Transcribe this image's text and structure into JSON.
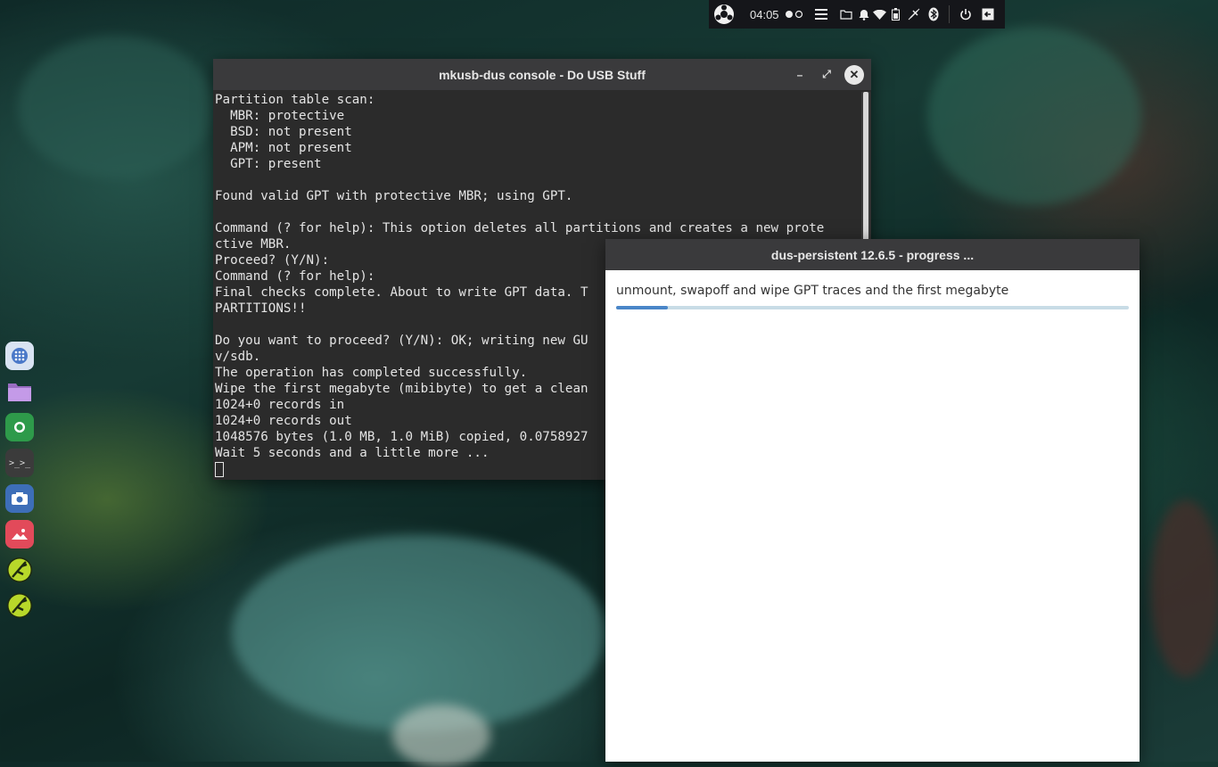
{
  "top_panel": {
    "logo_icon": "ubuntu-budgie-logo-icon",
    "clock": "04:05",
    "icons": [
      "workspace-dots-icon",
      "menu-icon",
      "folder-icon",
      "bell-icon",
      "wifi-icon",
      "battery-icon",
      "network-off-icon",
      "bluetooth-icon",
      "power-icon",
      "logout-icon"
    ]
  },
  "dock": {
    "items": [
      {
        "name": "app-grid-icon",
        "color": "#c8d6ea"
      },
      {
        "name": "files-icon",
        "color": "#b58ad8"
      },
      {
        "name": "chrome-icon",
        "color": "#2e9a4a"
      },
      {
        "name": "terminal-icon",
        "color": "#3b3b3b"
      },
      {
        "name": "screenshot-icon",
        "color": "#3d6eb8"
      },
      {
        "name": "image-viewer-icon",
        "color": "#e24a5a"
      },
      {
        "name": "mkusb-icon",
        "color": "#b8d82a"
      },
      {
        "name": "mkusb-icon-2",
        "color": "#b8d82a"
      }
    ]
  },
  "console": {
    "title": "mkusb-dus console - Do USB Stuff",
    "minimize": "–",
    "maximize": "⤢",
    "close": "✕",
    "lines": [
      "Partition table scan:",
      "  MBR: protective",
      "  BSD: not present",
      "  APM: not present",
      "  GPT: present",
      "",
      "Found valid GPT with protective MBR; using GPT.",
      "",
      "Command (? for help): This option deletes all partitions and creates a new prote",
      "ctive MBR.",
      "Proceed? (Y/N):",
      "Command (? for help):",
      "Final checks complete. About to write GPT data. T",
      "PARTITIONS!!",
      "",
      "Do you want to proceed? (Y/N): OK; writing new GU",
      "v/sdb.",
      "The operation has completed successfully.",
      "Wipe the first megabyte (mibibyte) to get a clean",
      "1024+0 records in",
      "1024+0 records out",
      "1048576 bytes (1.0 MB, 1.0 MiB) copied, 0.0758927",
      "Wait 5 seconds and a little more ..."
    ]
  },
  "progress": {
    "title": "dus-persistent 12.6.5 - progress ...",
    "message": "unmount, swapoff and wipe GPT traces and the first megabyte",
    "fraction": 0.1
  }
}
